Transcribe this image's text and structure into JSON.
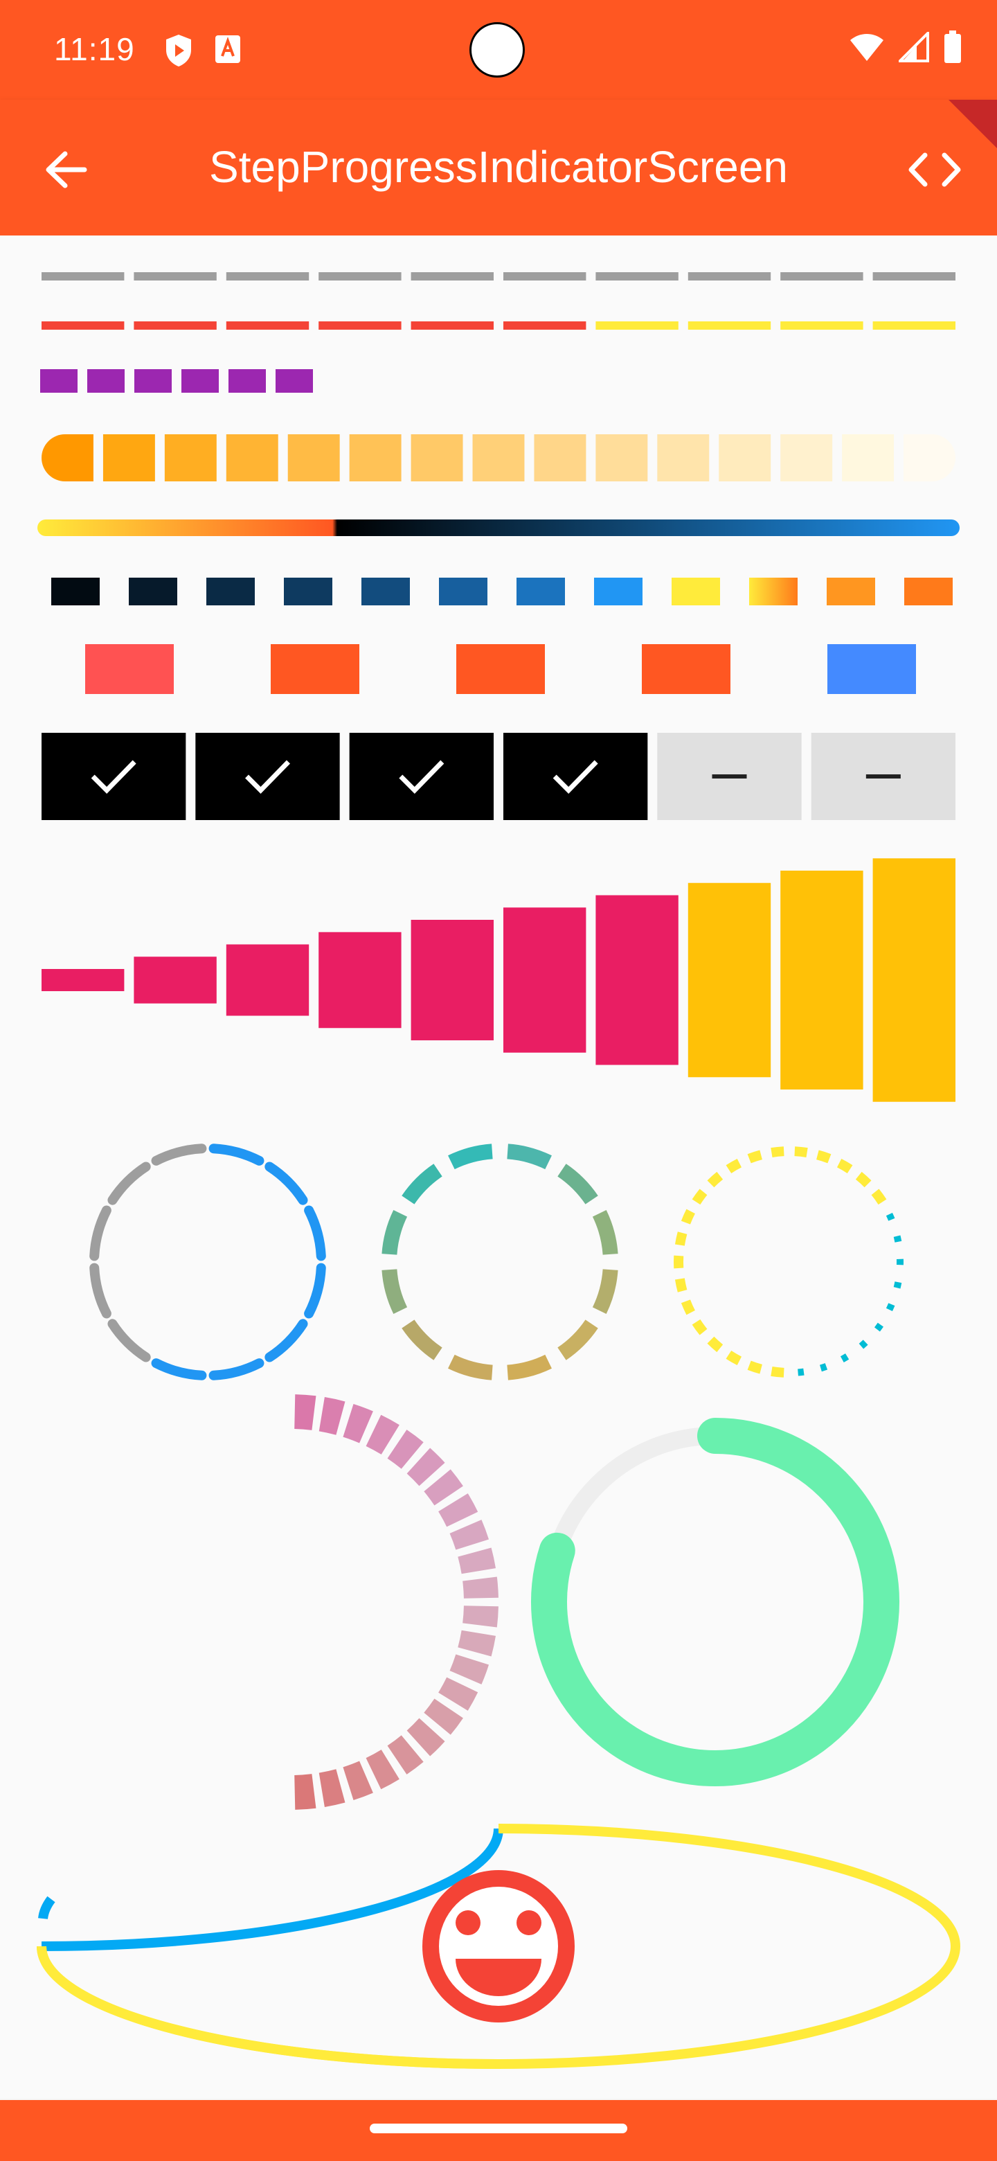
{
  "status_bar": {
    "time": "11:19",
    "left_icons": [
      "shield-icon",
      "text-a-icon"
    ],
    "right_icons": [
      "wifi-icon",
      "signal-icon",
      "battery-icon"
    ]
  },
  "app_bar": {
    "title": "StepProgressIndicatorScreen",
    "back_icon": "arrow-back-icon",
    "code_icon": "code-icon"
  },
  "colors": {
    "primary": "#ff5722",
    "grey": "#9e9e9e",
    "red": "#f44336",
    "yellow": "#ffeb3b",
    "purple": "#9c27b0",
    "pink": "#e91e63",
    "amber": "#ffc107",
    "blue": "#2196f3",
    "green": "#69f0ae"
  },
  "indicators": {
    "grey_steps_total": 10,
    "red_yellow_steps": {
      "total": 10,
      "current": 6
    },
    "purple_steps": 6,
    "orange_fade_steps": 15,
    "blue_square_steps": {
      "total": 12,
      "current": 8
    },
    "block_steps": 5,
    "check_steps": {
      "total": 6,
      "current": 4,
      "done_icon": "check-icon",
      "pending_icon": "minus-icon"
    },
    "growing_bars": {
      "total": 10,
      "current": 7
    },
    "circle_blue": {
      "total": 12,
      "current": 7
    },
    "circle_gradient": {
      "total": 12
    },
    "circle_dotted": {
      "total": 30,
      "current": 20
    },
    "half_circle_pink": {
      "total": 22
    },
    "ring_green": {
      "progress": 0.8
    },
    "ellipse": {
      "blue_fraction": 0.25,
      "face_icon": "smiley-face-icon"
    }
  }
}
